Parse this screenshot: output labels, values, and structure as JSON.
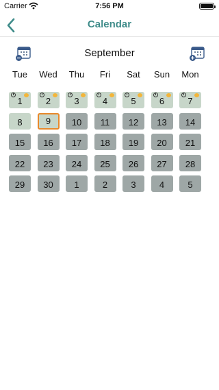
{
  "status_bar": {
    "carrier": "Carrier",
    "time": "7:56 PM"
  },
  "nav": {
    "title": "Calendar"
  },
  "month": {
    "label": "September"
  },
  "weekdays": [
    "Tue",
    "Wed",
    "Thu",
    "Fri",
    "Sat",
    "Sun",
    "Mon"
  ],
  "days": [
    {
      "label": "1",
      "state": "past",
      "marked": true
    },
    {
      "label": "2",
      "state": "past",
      "marked": true
    },
    {
      "label": "3",
      "state": "past",
      "marked": true
    },
    {
      "label": "4",
      "state": "past",
      "marked": true
    },
    {
      "label": "5",
      "state": "past",
      "marked": true
    },
    {
      "label": "6",
      "state": "past",
      "marked": true
    },
    {
      "label": "7",
      "state": "past",
      "marked": true
    },
    {
      "label": "8",
      "state": "past",
      "marked": false
    },
    {
      "label": "9",
      "state": "selected",
      "marked": false
    },
    {
      "label": "10",
      "state": "future",
      "marked": false
    },
    {
      "label": "11",
      "state": "future",
      "marked": false
    },
    {
      "label": "12",
      "state": "future",
      "marked": false
    },
    {
      "label": "13",
      "state": "future",
      "marked": false
    },
    {
      "label": "14",
      "state": "future",
      "marked": false
    },
    {
      "label": "15",
      "state": "future",
      "marked": false
    },
    {
      "label": "16",
      "state": "future",
      "marked": false
    },
    {
      "label": "17",
      "state": "future",
      "marked": false
    },
    {
      "label": "18",
      "state": "future",
      "marked": false
    },
    {
      "label": "19",
      "state": "future",
      "marked": false
    },
    {
      "label": "20",
      "state": "future",
      "marked": false
    },
    {
      "label": "21",
      "state": "future",
      "marked": false
    },
    {
      "label": "22",
      "state": "future",
      "marked": false
    },
    {
      "label": "23",
      "state": "future",
      "marked": false
    },
    {
      "label": "24",
      "state": "future",
      "marked": false
    },
    {
      "label": "25",
      "state": "future",
      "marked": false
    },
    {
      "label": "26",
      "state": "future",
      "marked": false
    },
    {
      "label": "27",
      "state": "future",
      "marked": false
    },
    {
      "label": "28",
      "state": "future",
      "marked": false
    },
    {
      "label": "29",
      "state": "future",
      "marked": false
    },
    {
      "label": "30",
      "state": "future",
      "marked": false
    },
    {
      "label": "1",
      "state": "future",
      "marked": false
    },
    {
      "label": "2",
      "state": "future",
      "marked": false
    },
    {
      "label": "3",
      "state": "future",
      "marked": false
    },
    {
      "label": "4",
      "state": "future",
      "marked": false
    },
    {
      "label": "5",
      "state": "future",
      "marked": false
    }
  ],
  "icons": {
    "back": "chevron-left-icon",
    "prev_month": "calendar-minus-icon",
    "next_month": "calendar-plus-icon",
    "day_mark": "clock-icon",
    "day_face": "smiley-icon"
  },
  "colors": {
    "accent": "#3f8c8a",
    "past_day": "#c7d6c9",
    "future_day": "#9ea7a6",
    "selected_border": "#e8892b"
  }
}
